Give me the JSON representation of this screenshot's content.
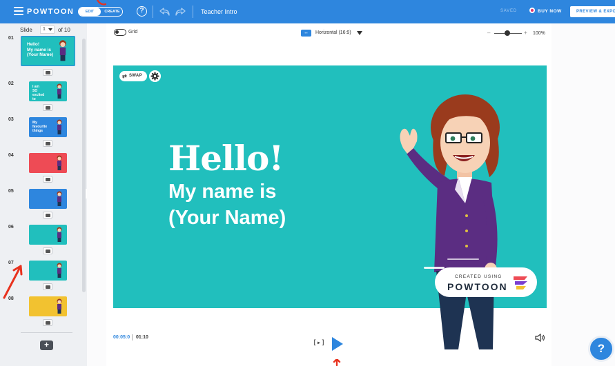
{
  "app": {
    "brand": "POWTOON",
    "mode_edit": "EDIT",
    "mode_create": "CREATE",
    "help_glyph": "?",
    "project_title": "Teacher Intro",
    "saved_status": "SAVED",
    "buy_now": "BUY NOW",
    "preview_export": "PREVIEW & EXPORT"
  },
  "slides_panel": {
    "slide_label": "Slide",
    "current_slide": "1",
    "of_total": "of 10",
    "collapse_glyph": "‹",
    "add_glyph": "+",
    "items": [
      {
        "num": "01",
        "text": "Hello!\nMy name is\n(Your Name)",
        "bg": "#21bfbd",
        "active": true
      },
      {
        "num": "02",
        "text": "I am\nSO\nexcited\nto\nbe your",
        "bg": "#21bfbd",
        "active": false
      },
      {
        "num": "03",
        "text": "My\nfavourite\nthings",
        "bg": "#2e86de",
        "active": false
      },
      {
        "num": "04",
        "text": "",
        "bg": "#ee4b55",
        "active": false
      },
      {
        "num": "05",
        "text": "",
        "bg": "#2e86de",
        "active": false
      },
      {
        "num": "06",
        "text": "",
        "bg": "#21bfbd",
        "active": false
      },
      {
        "num": "07",
        "text": "",
        "bg": "#21bfbd",
        "active": false
      },
      {
        "num": "08",
        "text": "",
        "bg": "#f2c230",
        "active": false
      }
    ]
  },
  "toolbar": {
    "grid_label": "Grid",
    "aspect_label": "Horizontal (16:9)",
    "zoom_minus": "–",
    "zoom_plus": "+",
    "zoom_value": "100%"
  },
  "canvas": {
    "swap_label": "SWAP",
    "headline": "Hello!",
    "subline1": "My name is",
    "subline2": "(Your Name)",
    "badge_top": "CREATED USING",
    "badge_logo": "POWTOON",
    "bg_color": "#21bfbd"
  },
  "playback": {
    "current_time": "00:05:0",
    "total_time": "01:10",
    "play_scene_glyph": "[▸]"
  },
  "colors": {
    "accent": "#2e86de",
    "canvas": "#21bfbd",
    "annotation": "#e8321e"
  }
}
